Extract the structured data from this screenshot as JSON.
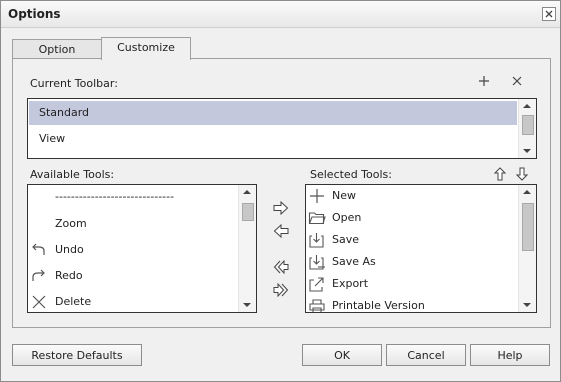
{
  "window": {
    "title": "Options"
  },
  "tabs": [
    {
      "label": "Option"
    },
    {
      "label": "Customize"
    }
  ],
  "current_toolbar": {
    "label": "Current Toolbar:",
    "items": [
      {
        "label": "Standard"
      },
      {
        "label": "View"
      }
    ],
    "selected": "Standard"
  },
  "available_tools": {
    "label": "Available Tools:",
    "items": [
      {
        "label": "------------------------------",
        "icon": ""
      },
      {
        "label": "Zoom",
        "icon": ""
      },
      {
        "label": "Undo",
        "icon": "undo-icon"
      },
      {
        "label": "Redo",
        "icon": "redo-icon"
      },
      {
        "label": "Delete",
        "icon": "delete-icon"
      }
    ]
  },
  "selected_tools": {
    "label": "Selected Tools:",
    "items": [
      {
        "label": "New",
        "icon": "new-icon"
      },
      {
        "label": "Open",
        "icon": "open-folder-icon"
      },
      {
        "label": "Save",
        "icon": "save-icon"
      },
      {
        "label": "Save As",
        "icon": "save-as-icon"
      },
      {
        "label": "Export",
        "icon": "export-icon"
      },
      {
        "label": "Printable Version",
        "icon": "printable-version-icon"
      }
    ]
  },
  "buttons": {
    "restore": "Restore Defaults",
    "ok": "OK",
    "cancel": "Cancel",
    "help": "Help"
  }
}
